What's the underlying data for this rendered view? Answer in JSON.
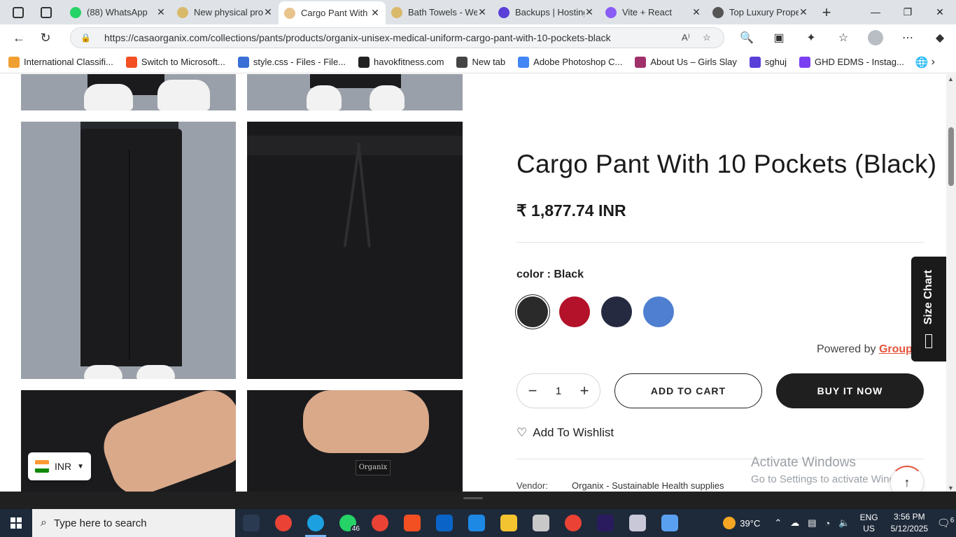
{
  "browser": {
    "tabs": [
      {
        "title": "(88) WhatsApp",
        "fav_color": "#25d366",
        "active": false
      },
      {
        "title": "New physical pro",
        "fav_color": "#d9b96a",
        "active": false
      },
      {
        "title": "Cargo Pant With",
        "fav_color": "#e9c38c",
        "active": true
      },
      {
        "title": "Bath Towels - We",
        "fav_color": "#d9b96a",
        "active": false
      },
      {
        "title": "Backups | Hosting",
        "fav_color": "#5a3fd9",
        "active": false
      },
      {
        "title": "Vite + React",
        "fav_color": "#8a5cf6",
        "active": false
      },
      {
        "title": "Top Luxury Prope",
        "fav_color": "#555555",
        "active": false
      }
    ],
    "url": "https://casaorganix.com/collections/pants/products/organix-unisex-medical-uniform-cargo-pant-with-10-pockets-black",
    "bookmarks": [
      {
        "label": "International Classifi...",
        "color": "#f0a030"
      },
      {
        "label": "Switch to Microsoft...",
        "color": "#f25022"
      },
      {
        "label": "style.css - Files - File...",
        "color": "#3b6fd8"
      },
      {
        "label": "havokfitness.com",
        "color": "#222222"
      },
      {
        "label": "New tab",
        "color": "#444444"
      },
      {
        "label": "Adobe Photoshop C...",
        "color": "#4285f4"
      },
      {
        "label": "About Us – Girls Slay",
        "color": "#a0306a"
      },
      {
        "label": "sghuj",
        "color": "#5a3fd9"
      },
      {
        "label": "GHD EDMS - Instag...",
        "color": "#7b3ff2"
      }
    ]
  },
  "product": {
    "title": "Cargo Pant With 10 Pockets (Black)",
    "price": "₹ 1,877.74 INR",
    "color_label": "color",
    "color_value": ": Black",
    "swatches": [
      {
        "name": "Black",
        "color": "#2a2a2a",
        "selected": true
      },
      {
        "name": "Red",
        "color": "#b3122a",
        "selected": false
      },
      {
        "name": "Navy",
        "color": "#252a40",
        "selected": false
      },
      {
        "name": "Blue",
        "color": "#4e7fd0",
        "selected": false
      }
    ],
    "powered_by": "Powered by ",
    "powered_brand": "Groupt",
    "quantity": "1",
    "minus": "−",
    "plus": "+",
    "add_to_cart": "ADD TO CART",
    "buy_now": "BUY IT NOW",
    "wishlist": "Add To Wishlist",
    "vendor_label": "Vendor:",
    "vendor_value": "Organix - Sustainable Health supplies"
  },
  "size_chart": "Size Chart",
  "currency": "INR",
  "watermark": {
    "line1": "Activate Windows",
    "line2": "Go to Settings to activate Windows."
  },
  "taskbar": {
    "search_placeholder": "Type here to search",
    "weather": "39°C",
    "lang1": "ENG",
    "lang2": "US",
    "time": "3:56 PM",
    "date": "5/12/2025",
    "notifications": "6",
    "whatsapp_badge": "46",
    "apps": [
      {
        "name": "task-view",
        "color": "#2a3a50"
      },
      {
        "name": "chrome",
        "color": "#ea4335"
      },
      {
        "name": "edge",
        "color": "#1ca0e0"
      },
      {
        "name": "whatsapp",
        "color": "#25d366"
      },
      {
        "name": "chrome-2",
        "color": "#ea4335"
      },
      {
        "name": "store",
        "color": "#f25022"
      },
      {
        "name": "outlook",
        "color": "#0a64c8"
      },
      {
        "name": "vscode",
        "color": "#1e88e5"
      },
      {
        "name": "explorer",
        "color": "#f4c430"
      },
      {
        "name": "app-generic",
        "color": "#c8c8c8"
      },
      {
        "name": "chrome-3",
        "color": "#ea4335"
      },
      {
        "name": "premiere",
        "color": "#2a1a5e"
      },
      {
        "name": "app-dark",
        "color": "#c8c8d8"
      },
      {
        "name": "feather",
        "color": "#5aa0f0"
      }
    ]
  }
}
